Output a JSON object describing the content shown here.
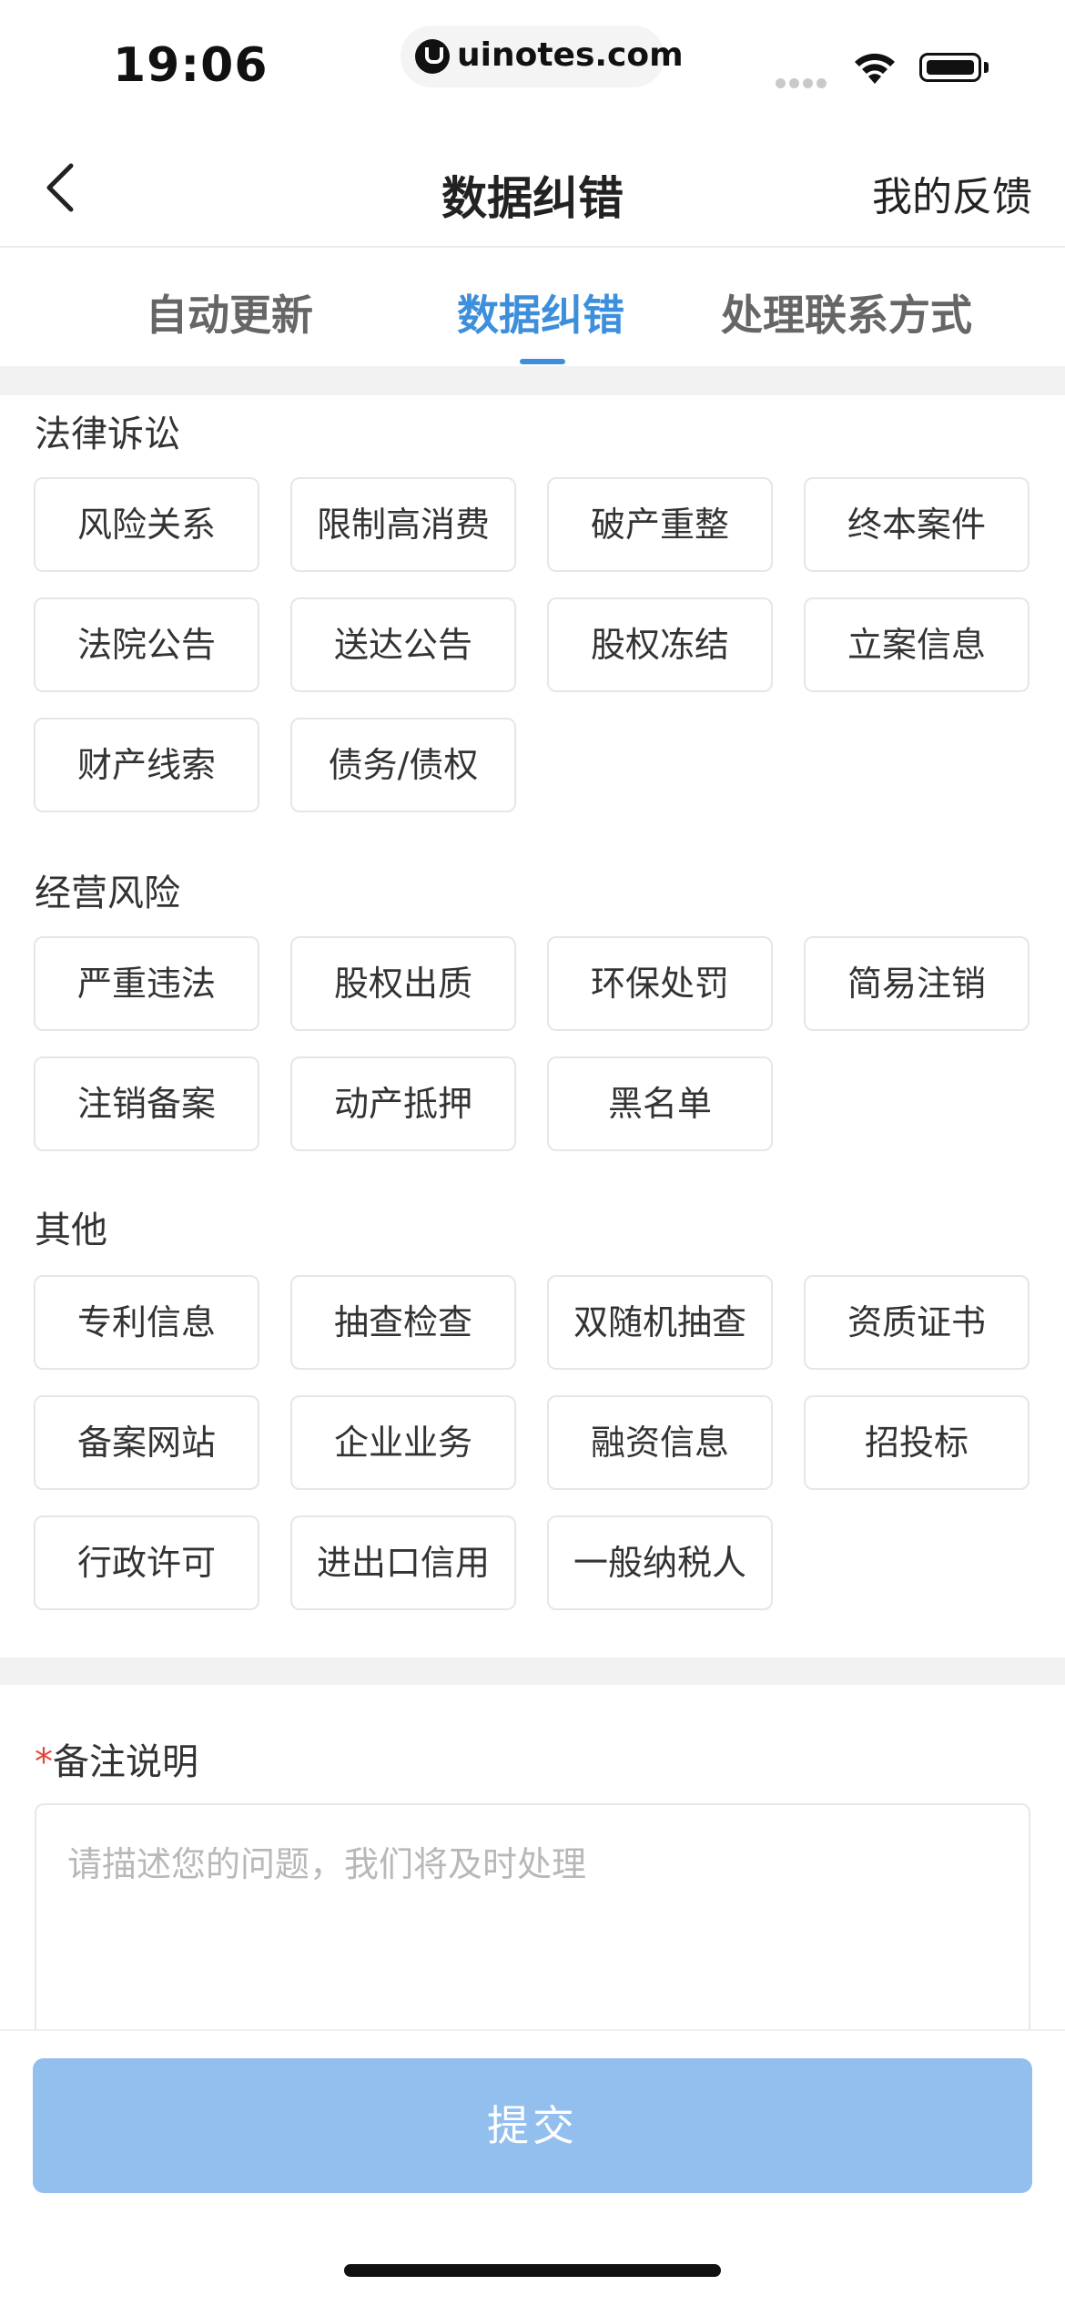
{
  "status_bar": {
    "time": "19:06",
    "url": "uinotes.com"
  },
  "nav": {
    "title": "数据纠错",
    "right_label": "我的反馈"
  },
  "tabs": [
    {
      "label": "自动更新",
      "active": false
    },
    {
      "label": "数据纠错",
      "active": true
    },
    {
      "label": "处理联系方式",
      "active": false
    }
  ],
  "sections": [
    {
      "title": "法律诉讼",
      "items": [
        "风险关系",
        "限制高消费",
        "破产重整",
        "终本案件",
        "法院公告",
        "送达公告",
        "股权冻结",
        "立案信息",
        "财产线索",
        "债务/债权"
      ]
    },
    {
      "title": "经营风险",
      "items": [
        "严重违法",
        "股权出质",
        "环保处罚",
        "简易注销",
        "注销备案",
        "动产抵押",
        "黑名单"
      ]
    },
    {
      "title": "其他",
      "items": [
        "专利信息",
        "抽查检查",
        "双随机抽查",
        "资质证书",
        "备案网站",
        "企业业务",
        "融资信息",
        "招投标",
        "行政许可",
        "进出口信用",
        "一般纳税人"
      ]
    }
  ],
  "remark": {
    "required_mark": "*",
    "label": "备注说明",
    "placeholder": "请描述您的问题，我们将及时处理"
  },
  "submit_label": "提交",
  "colors": {
    "accent": "#3d8fdc",
    "submit_disabled": "#93bfef",
    "required": "#e0483f"
  }
}
